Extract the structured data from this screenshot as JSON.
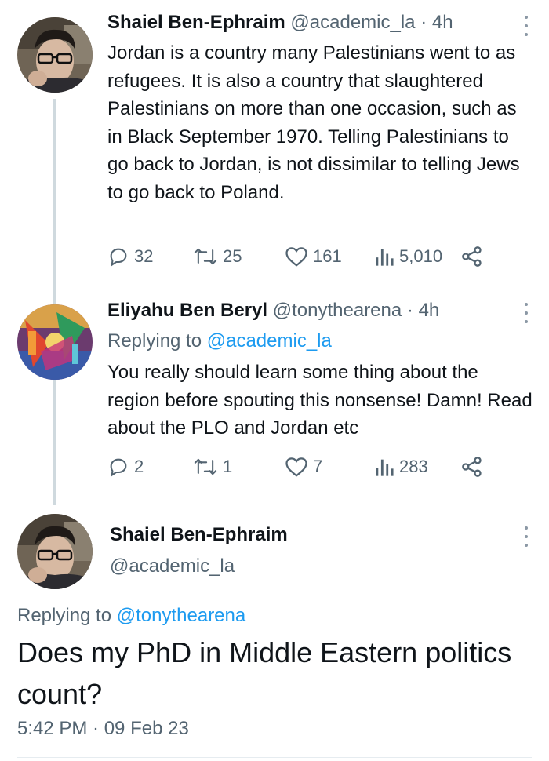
{
  "tweet1": {
    "name": "Shaiel Ben-Ephraim",
    "handle": "@academic_la",
    "time": "· 4h",
    "text": "Jordan is a country many Palestinians went to as refugees. It is also a country that slaughtered Palestinians on more than one occasion, such as in Black September 1970. Telling Palestinians to go back to Jordan, is not dissimilar to telling Jews to go back to Poland.",
    "replies": "32",
    "retweets": "25",
    "likes": "161",
    "views": "5,010"
  },
  "tweet2": {
    "name": "Eliyahu Ben Beryl",
    "handle": "@tonythearena",
    "time": "· 4h",
    "replying_prefix": "Replying to",
    "replying_to": "@academic_la",
    "text": "You really should learn some thing about the region before spouting this nonsense!  Damn! Read about the PLO and Jordan etc",
    "replies": "2",
    "retweets": "1",
    "likes": "7",
    "views": "283"
  },
  "main_tweet": {
    "name": "Shaiel Ben-Ephraim",
    "handle": "@academic_la",
    "replying_prefix": "Replying to",
    "replying_to": "@tonythearena",
    "text": "Does my PhD in Middle Eastern politics count?",
    "timestamp": "5:42 PM · 09 Feb 23"
  },
  "icons": {
    "reply": "reply-icon",
    "retweet": "retweet-icon",
    "like": "heart-icon",
    "views": "views-icon",
    "share": "share-icon",
    "more": "more-icon"
  },
  "colors": {
    "link": "#1d9bf0",
    "secondary_text": "#536471",
    "thread_line": "#cfd9de"
  }
}
